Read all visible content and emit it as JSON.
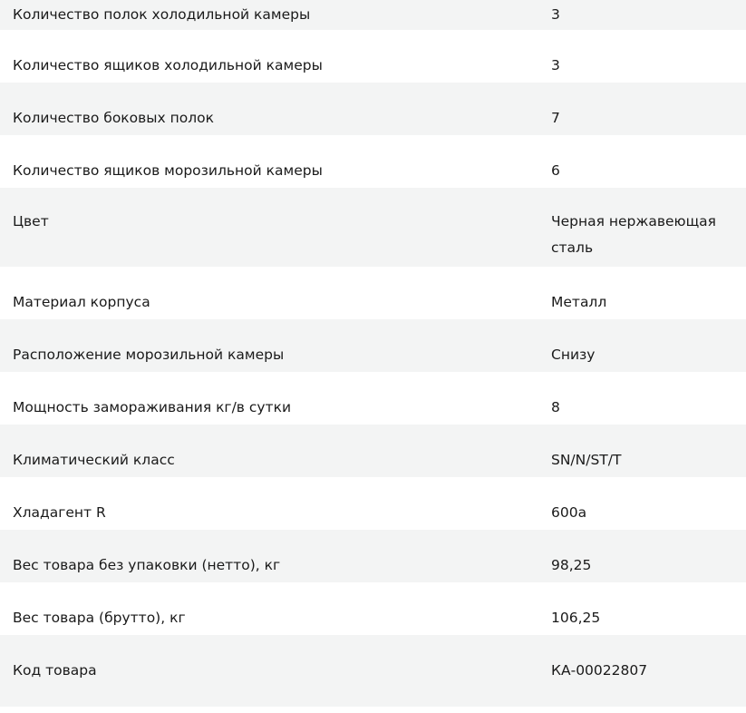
{
  "specs": [
    {
      "label": "Количество полок холодильной камеры",
      "value": "3"
    },
    {
      "label": "Количество ящиков холодильной камеры",
      "value": "3"
    },
    {
      "label": "Количество боковых полок",
      "value": "7"
    },
    {
      "label": "Количество ящиков морозильной камеры",
      "value": "6"
    },
    {
      "label": "Цвет",
      "value": "Черная нержавеющая сталь"
    },
    {
      "label": "Материал корпуса",
      "value": "Металл"
    },
    {
      "label": "Расположение морозильной камеры",
      "value": "Снизу"
    },
    {
      "label": "Мощность замораживания кг/в сутки",
      "value": "8"
    },
    {
      "label": "Климатический класс",
      "value": "SN/N/ST/T"
    },
    {
      "label": "Хладагент R",
      "value": "600a"
    },
    {
      "label": "Вес товара без упаковки (нетто), кг",
      "value": "98,25"
    },
    {
      "label": "Вес товара (брутто), кг",
      "value": "106,25"
    },
    {
      "label": "Код товара",
      "value": "КА-00022807"
    }
  ]
}
